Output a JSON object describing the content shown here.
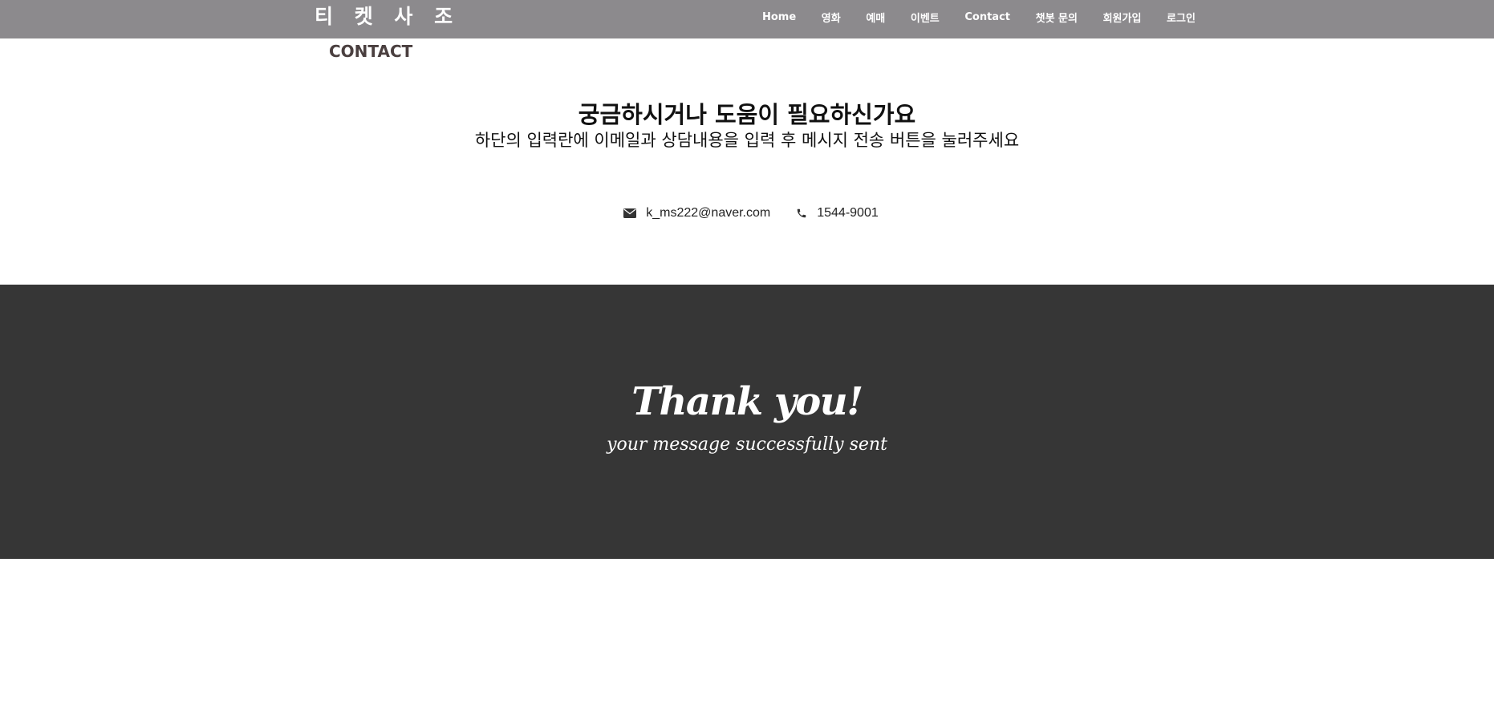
{
  "header": {
    "brand": "티 켓 사 조",
    "nav": [
      {
        "label": "Home"
      },
      {
        "label": "영화"
      },
      {
        "label": "예매"
      },
      {
        "label": "이벤트"
      },
      {
        "label": "Contact"
      },
      {
        "label": "챗봇 문의"
      },
      {
        "label": "회원가입"
      },
      {
        "label": "로그인"
      }
    ],
    "bar_color": "#8c8a8d"
  },
  "page_label": "CONTACT",
  "intro": {
    "title": "궁금하시거나 도움이 필요하신가요",
    "subtitle": "하단의 입력란에 이메일과 상담내용을 입력 후 메시지 전송 버튼을 눌러주세요"
  },
  "contacts": {
    "email": {
      "icon": "envelope-icon",
      "text": "k_ms222@naver.com"
    },
    "phone": {
      "icon": "phone-icon",
      "text": "1544-9001"
    }
  },
  "thanks": {
    "title": "Thank you!",
    "subtitle": "your message successfully sent",
    "background": "#363636"
  }
}
